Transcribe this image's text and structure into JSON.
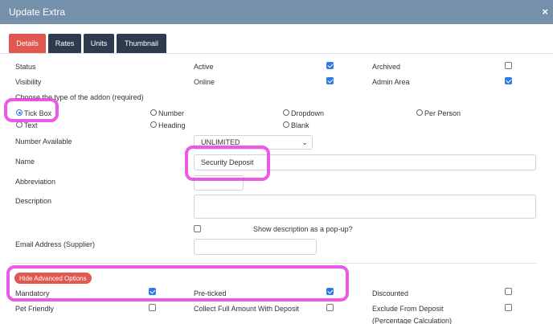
{
  "window": {
    "title": "Update Extra",
    "close_icon": "×"
  },
  "tabs": [
    "Details",
    "Rates",
    "Units",
    "Thumbnail"
  ],
  "status": {
    "label": "Status",
    "active_label": "Active",
    "archived_label": "Archived",
    "active": true,
    "archived": false
  },
  "visibility": {
    "label": "Visibility",
    "online_label": "Online",
    "admin_label": "Admin Area",
    "online": true,
    "admin": true
  },
  "addon_type": {
    "label": "Choose the type of the addon (required)",
    "options": [
      "Tick Box",
      "Number",
      "Dropdown",
      "Per Person",
      "Text",
      "Heading",
      "Blank"
    ],
    "selected": "Tick Box"
  },
  "number_available": {
    "label": "Number Available",
    "value": "UNLIMITED"
  },
  "name": {
    "label": "Name",
    "value": "Security Deposit"
  },
  "abbreviation": {
    "label": "Abbreviation",
    "value": ""
  },
  "description": {
    "label": "Description",
    "value": "",
    "popup_label": "Show description as a pop-up?",
    "popup": false
  },
  "email": {
    "label": "Email Address (Supplier)",
    "value": ""
  },
  "advanced": {
    "toggle_label": "Hide Advanced Options"
  },
  "options": {
    "mandatory_label": "Mandatory",
    "mandatory": true,
    "preticked_label": "Pre-ticked",
    "preticked": true,
    "discounted_label": "Discounted",
    "discounted": false,
    "pet_friendly_label": "Pet Friendly",
    "pet_friendly": false,
    "collect_full_label": "Collect Full Amount With Deposit",
    "collect_full": false,
    "exclude_label": "Exclude From Deposit",
    "exclude_note": "(Percentage Calculation)",
    "exclude": false
  },
  "colors": {
    "header": "#7590ab",
    "tab": "#2e3b4e",
    "tab_active": "#e0584f",
    "check": "#2f7ae5",
    "highlight": "#e93ce0"
  }
}
